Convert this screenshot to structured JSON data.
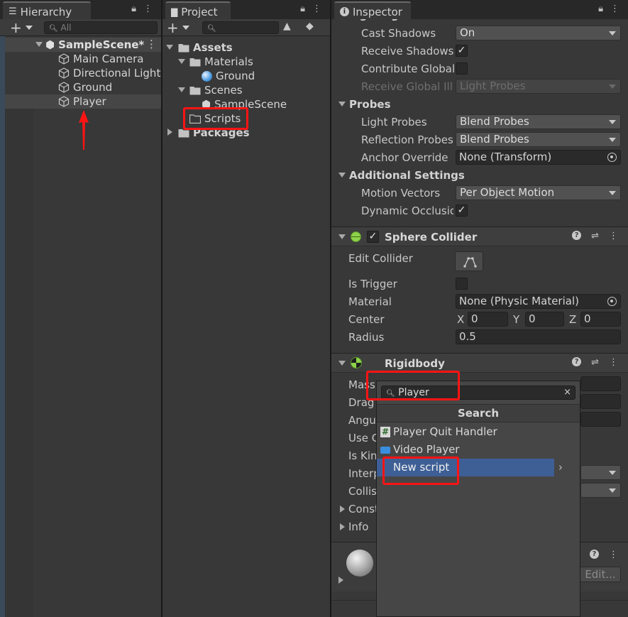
{
  "hierarchy": {
    "tab_title": "Hierarchy",
    "search_placeholder": "All",
    "scene": "SampleScene*",
    "items": [
      "Main Camera",
      "Directional Light",
      "Ground",
      "Player"
    ]
  },
  "project": {
    "tab_title": "Project",
    "root": "Assets",
    "materials": "Materials",
    "ground_material": "Ground",
    "scenes": "Scenes",
    "sample_scene": "SampleScene",
    "scripts": "Scripts",
    "packages": "Packages"
  },
  "inspector": {
    "tab_title": "Inspector",
    "lighting_header": "Lighting",
    "cast_shadows_label": "Cast Shadows",
    "cast_shadows_value": "On",
    "receive_shadows_label": "Receive Shadows",
    "receive_shadows_checked": true,
    "contribute_gi_label": "Contribute Global",
    "receive_gi_label": "Receive Global Illu",
    "receive_gi_value": "Light Probes",
    "probes_header": "Probes",
    "light_probes_label": "Light Probes",
    "light_probes_value": "Blend Probes",
    "reflection_probes_label": "Reflection Probes",
    "reflection_probes_value": "Blend Probes",
    "anchor_override_label": "Anchor Override",
    "anchor_override_value": "None (Transform)",
    "additional_header": "Additional Settings",
    "motion_vectors_label": "Motion Vectors",
    "motion_vectors_value": "Per Object Motion",
    "dynamic_occlusion_label": "Dynamic Occlusic",
    "dynamic_occlusion_checked": true,
    "sphere_collider": {
      "title": "Sphere Collider",
      "edit_collider_label": "Edit Collider",
      "is_trigger_label": "Is Trigger",
      "material_label": "Material",
      "material_value": "None (Physic Material)",
      "center_label": "Center",
      "center_x_label": "X",
      "center_x": "0",
      "center_y_label": "Y",
      "center_y": "0",
      "center_z_label": "Z",
      "center_z": "0",
      "radius_label": "Radius",
      "radius_value": "0.5"
    },
    "rigidbody": {
      "title": "Rigidbody",
      "rows": [
        "Mass",
        "Drag",
        "Angul",
        "Use G",
        "Is Kin",
        "Interp",
        "Collis",
        "Const",
        "Info"
      ]
    },
    "material_edit_button": "Edit..."
  },
  "add_component_popup": {
    "search_value": "Player",
    "heading": "Search",
    "items": [
      "Player Quit Handler",
      "Video Player",
      "New script"
    ]
  },
  "colors": {
    "highlight_red": "#ff1414",
    "selection_blue": "#3e5f96",
    "panel_bg": "#383838"
  }
}
